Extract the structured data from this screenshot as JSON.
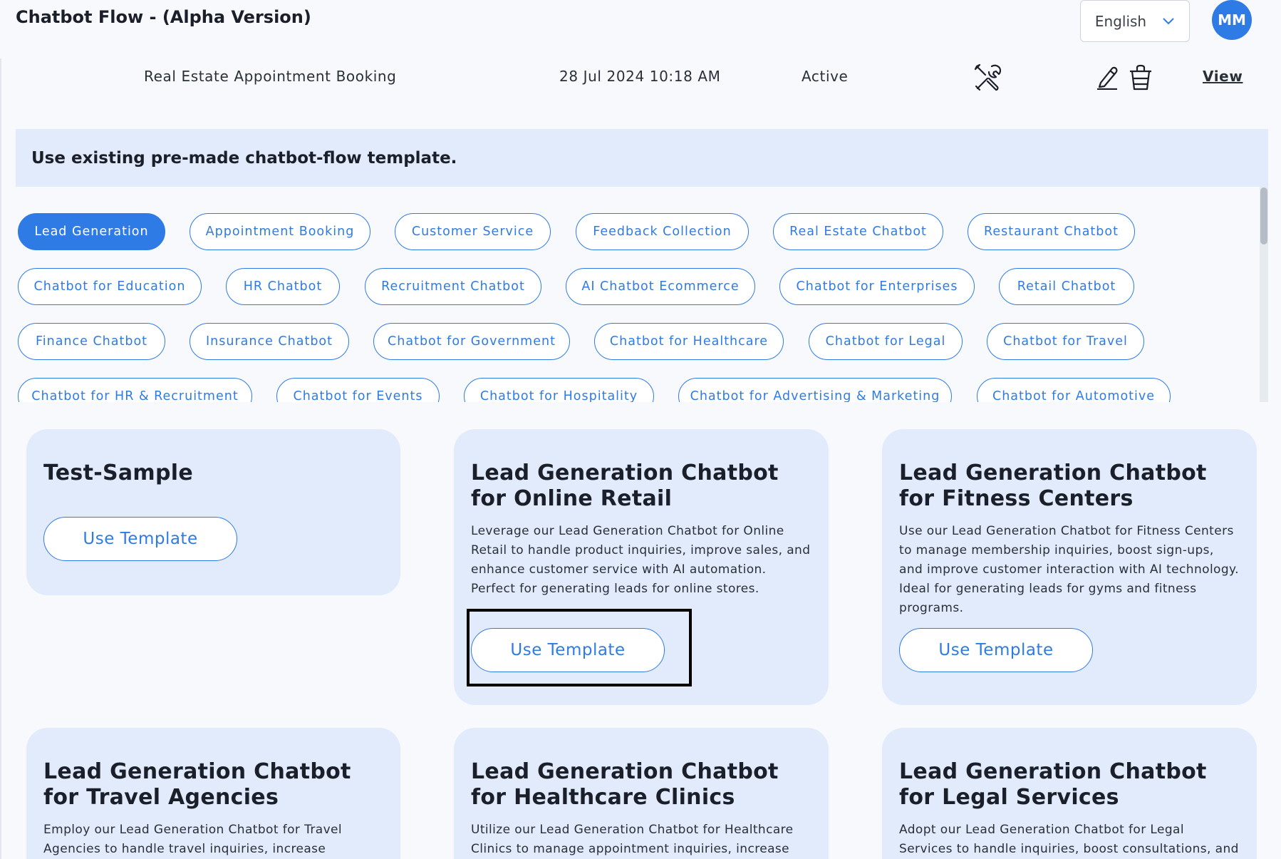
{
  "header": {
    "title": "Chatbot Flow - (Alpha Version)",
    "language": "English",
    "avatar_initials": "MM"
  },
  "flow": {
    "name": "Real Estate Appointment Booking",
    "date": "28 Jul 2024 10:18 AM",
    "status": "Active",
    "view_label": "View"
  },
  "banner": {
    "text": "Use existing pre-made chatbot-flow template."
  },
  "chips": [
    "Lead Generation",
    "Appointment Booking",
    "Customer Service",
    "Feedback Collection",
    "Real Estate Chatbot",
    "Restaurant Chatbot",
    "Chatbot for Education",
    "HR Chatbot",
    "Recruitment Chatbot",
    "AI Chatbot Ecommerce",
    "Chatbot for Enterprises",
    "Retail Chatbot",
    "Finance Chatbot",
    "Insurance Chatbot",
    "Chatbot for Government",
    "Chatbot for Healthcare",
    "Chatbot for Legal",
    "Chatbot for Travel",
    "Chatbot for HR & Recruitment",
    "Chatbot for Events",
    "Chatbot for Hospitality",
    "Chatbot for Advertising & Marketing",
    "Chatbot for Automotive"
  ],
  "active_chip": "Lead Generation",
  "cards": [
    {
      "title": "Test-Sample",
      "desc": "",
      "button": "Use Template"
    },
    {
      "title": "Lead Generation Chatbot for Online Retail",
      "desc": "Leverage our Lead Generation Chatbot for Online Retail to handle product inquiries, improve sales, and enhance customer service with AI automation. Perfect for generating leads for online stores.",
      "button": "Use Template"
    },
    {
      "title": "Lead Generation Chatbot for Fitness Centers",
      "desc": "Use our Lead Generation Chatbot for Fitness Centers to manage membership inquiries, boost sign-ups, and improve customer interaction with AI technology. Ideal for generating leads for gyms and fitness programs.",
      "button": "Use Template"
    },
    {
      "title": "Lead Generation Chatbot for Travel Agencies",
      "desc": "Employ our Lead Generation Chatbot for Travel Agencies to handle travel inquiries, increase bookings,",
      "button": ""
    },
    {
      "title": "Lead Generation Chatbot for Healthcare Clinics",
      "desc": "Utilize our Lead Generation Chatbot for Healthcare Clinics to manage appointment inquiries, increase",
      "button": ""
    },
    {
      "title": "Lead Generation Chatbot for Legal Services",
      "desc": "Adopt our Lead Generation Chatbot for Legal Services to handle inquiries, boost consultations, and improve",
      "button": ""
    }
  ],
  "colors": {
    "accent": "#2f7be5",
    "card_bg": "#e1ebfb",
    "highlight": "#000000"
  }
}
